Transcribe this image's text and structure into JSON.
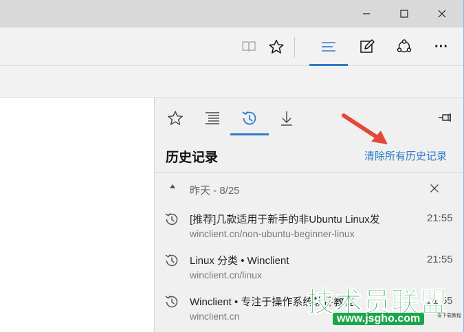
{
  "colors": {
    "accent": "#2c7cc7",
    "annotation_arrow": "#e04a3a",
    "watermark_green": "#1aa64a"
  },
  "window_controls": {
    "minimize_icon": "minimize-icon",
    "maximize_icon": "maximize-icon",
    "close_icon": "close-icon"
  },
  "toolbar": {
    "icons": [
      "reading-view-icon",
      "favorite-star-icon",
      "hub-icon",
      "web-note-icon",
      "share-icon",
      "more-icon"
    ],
    "more_label": "···"
  },
  "hub": {
    "tabs": [
      "favorites-icon",
      "reading-list-icon",
      "history-icon",
      "downloads-icon"
    ],
    "active_tab": "history",
    "title": "历史记录",
    "clear_all": "清除所有历史记录",
    "group": {
      "label": "昨天 - 8/25"
    },
    "items": [
      {
        "title": "[推荐]几款适用于新手的非Ubuntu Linux发",
        "url": "winclient.cn/non-ubuntu-beginner-linux",
        "time": "21:55"
      },
      {
        "title": "Linux 分类 • Winclient",
        "url": "winclient.cn/linux",
        "time": "21:55"
      },
      {
        "title": "Winclient • 专注于操作系统软件教程",
        "url": "winclient.cn",
        "time": "21:55"
      }
    ]
  },
  "watermark": {
    "brand": "技术员联盟",
    "url": "www.jsgho.com",
    "small": "安下载教程"
  }
}
